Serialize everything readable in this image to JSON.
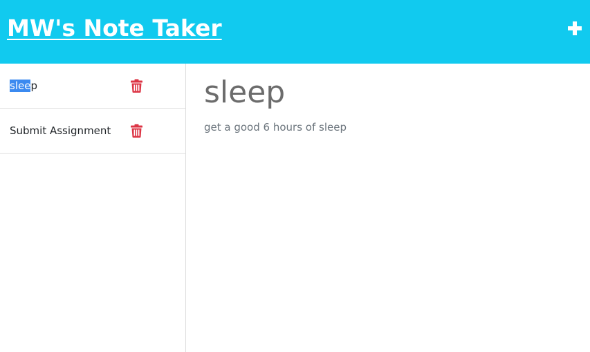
{
  "header": {
    "title": "MW's Note Taker",
    "new_note_icon": "plus-icon"
  },
  "sidebar": {
    "notes": [
      {
        "title_selected": "slee",
        "title_rest": "p",
        "delete_icon": "trash-icon"
      },
      {
        "title": "Submit Assignment",
        "delete_icon": "trash-icon"
      }
    ]
  },
  "main": {
    "note_title": "sleep",
    "note_text": "get a good 6 hours of sleep"
  },
  "colors": {
    "navbar": "#11caef",
    "delete": "#dc3545",
    "selection": "#3b8af0"
  }
}
